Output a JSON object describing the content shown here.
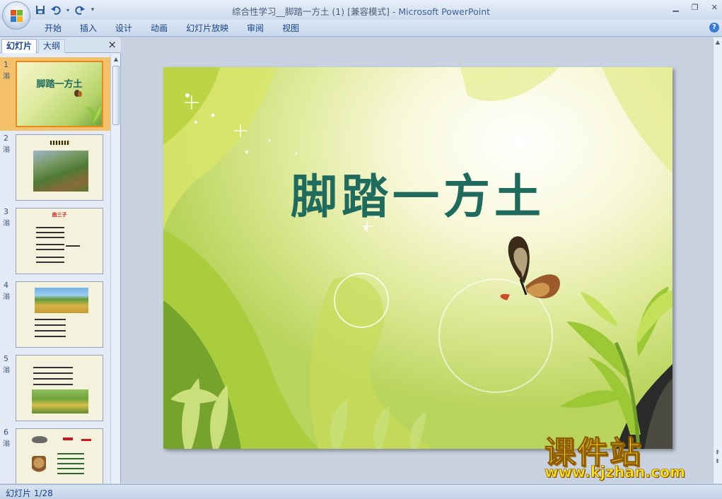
{
  "window": {
    "title": "综合性学习__脚踏一方土 (1) [兼容模式]",
    "app_name": "Microsoft PowerPoint",
    "separator": " - "
  },
  "quick_access": {
    "save_icon": "save-icon",
    "undo_icon": "undo-icon",
    "redo_icon": "redo-icon"
  },
  "ribbon": {
    "tabs": [
      "开始",
      "插入",
      "设计",
      "动画",
      "幻灯片放映",
      "审阅",
      "视图"
    ]
  },
  "left_pane": {
    "tab_slides": "幻灯片",
    "tab_outline": "大纲",
    "close": "×",
    "slides": [
      {
        "num": "1",
        "anim": "滃",
        "selected": true
      },
      {
        "num": "2",
        "anim": "滃",
        "selected": false
      },
      {
        "num": "3",
        "anim": "滃",
        "selected": false
      },
      {
        "num": "4",
        "anim": "滃",
        "selected": false
      },
      {
        "num": "5",
        "anim": "滃",
        "selected": false
      },
      {
        "num": "6",
        "anim": "滃",
        "selected": false
      }
    ],
    "thumb1_title": "脚踏一方土",
    "thumb3_title": "曲三子"
  },
  "slide": {
    "title": "脚踏一方土"
  },
  "watermark": {
    "brand": "课件站",
    "url": "www.kjzhan.com"
  },
  "status": {
    "slide_indicator": "幻灯片 1/28"
  },
  "colors": {
    "title_green": "#1f6b5d",
    "selection": "#f4c06a",
    "watermark_yellow": "#ffe11a"
  }
}
